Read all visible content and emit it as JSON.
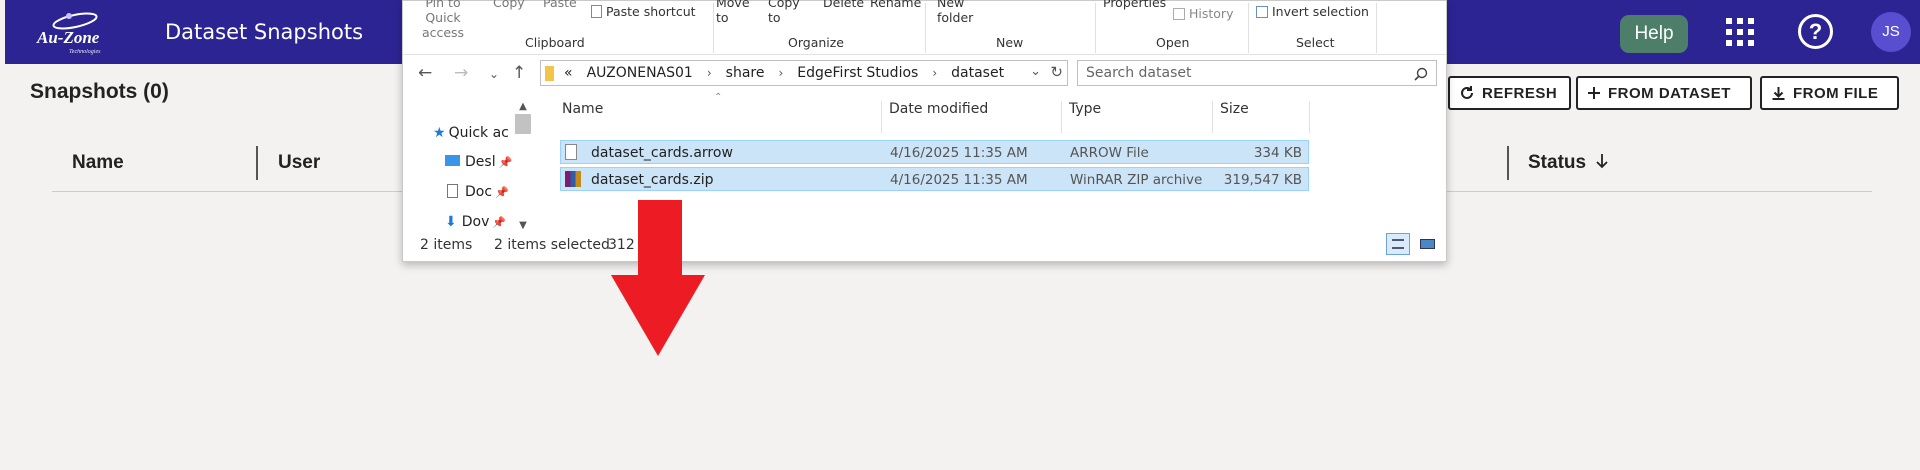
{
  "header": {
    "logo_text": "Au-Zone",
    "logo_subtext": "Technologies",
    "app_title": "Dataset Snapshots",
    "help_label": "Help",
    "avatar_initials": "JS",
    "color": "#2c2493"
  },
  "page": {
    "title": "Snapshots (0)",
    "buttons": {
      "refresh": "REFRESH",
      "from_dataset": "FROM DATASET",
      "from_file": "FROM FILE"
    },
    "columns": {
      "name": "Name",
      "user": "User",
      "status": "Status"
    },
    "status_sort_icon": "arrow-down-icon"
  },
  "explorer": {
    "ribbon": {
      "pin_quick_access": "Pin to Quick access",
      "copy": "Copy",
      "paste": "Paste",
      "paste_shortcut": "Paste shortcut",
      "move_to": "Move to",
      "copy_to": "Copy to",
      "delete": "Delete",
      "rename": "Rename",
      "new_folder": "New folder",
      "properties": "Properties",
      "history": "History",
      "invert_selection": "Invert selection",
      "groups": {
        "clipboard": "Clipboard",
        "organize": "Organize",
        "new": "New",
        "open": "Open",
        "select": "Select"
      }
    },
    "address": {
      "prefix": "«",
      "crumbs": [
        "AUZONENAS01",
        "share",
        "EdgeFirst Studios",
        "dataset"
      ]
    },
    "search_placeholder": "Search dataset",
    "nav_pane": [
      "Quick ac",
      "Desl",
      "Doc",
      "Dov"
    ],
    "columns": {
      "name": "Name",
      "date": "Date modified",
      "type": "Type",
      "size": "Size"
    },
    "files": [
      {
        "name": "dataset_cards.arrow",
        "date": "4/16/2025 11:35 AM",
        "type": "ARROW File",
        "size": "334 KB",
        "icon": "file-icon"
      },
      {
        "name": "dataset_cards.zip",
        "date": "4/16/2025 11:35 AM",
        "type": "WinRAR ZIP archive",
        "size": "319,547 KB",
        "icon": "winrar-icon"
      }
    ],
    "status": {
      "items": "2 items",
      "selected": "2 items selected",
      "size": "312"
    }
  },
  "annotation": {
    "arrow_color": "#ed1c24",
    "arrow_icon": "red-down-arrow-icon"
  }
}
